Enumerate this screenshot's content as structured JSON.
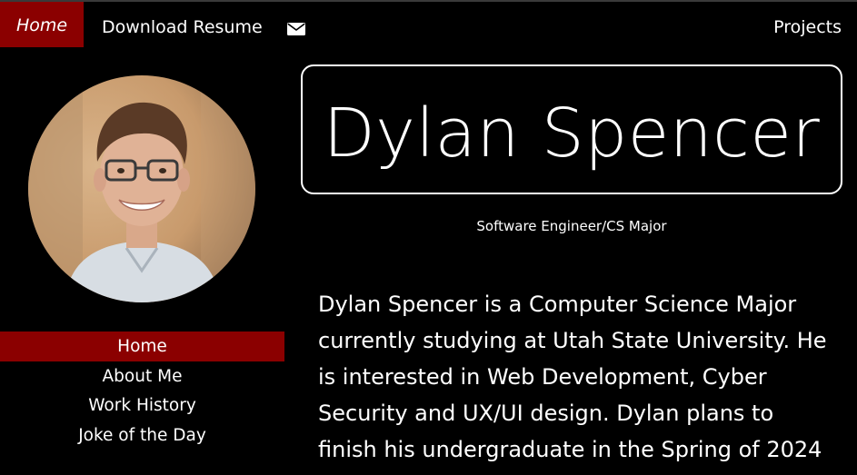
{
  "nav": {
    "home": "Home",
    "download": "Download Resume",
    "mail_icon": "envelope-icon",
    "projects": "Projects"
  },
  "profile": {
    "name": "Dylan Spencer",
    "subtitle": "Software Engineer/CS Major",
    "bio": "Dylan Spencer is a Computer Science Major currently studying at Utah State University. He is interested in Web Development, Cyber Security and UX/UI design. Dylan plans to finish his undergraduate in the Spring of 2024"
  },
  "sidebar": {
    "items": [
      {
        "label": "Home"
      },
      {
        "label": "About Me"
      },
      {
        "label": "Work History"
      },
      {
        "label": "Joke of the Day"
      }
    ]
  },
  "colors": {
    "accent": "#8b0000",
    "background": "#000000",
    "text": "#ffffff"
  }
}
